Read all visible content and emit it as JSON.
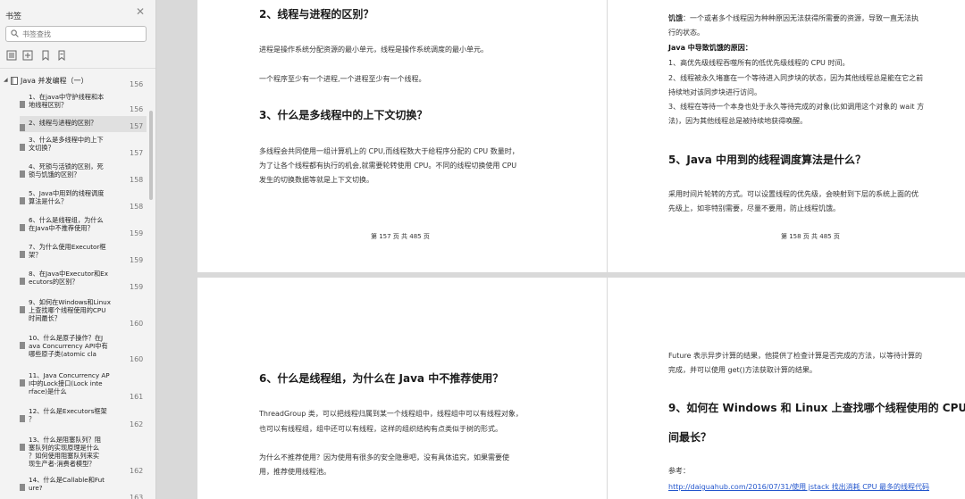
{
  "sidebar": {
    "title": "书签",
    "search_placeholder": "书签查找",
    "root": {
      "label": "Java 并发编程（一）",
      "page": "156"
    },
    "items": [
      {
        "label": "1、在java中守护线程和本\n地线程区别？",
        "page": "156"
      },
      {
        "label": "2、线程与进程的区别？",
        "page": "157"
      },
      {
        "label": "3、什么是多线程中的上下\n文切换？",
        "page": "157"
      },
      {
        "label": "4、死锁与活锁的区别，死\n锁与饥饿的区别？",
        "page": "158"
      },
      {
        "label": "5、Java中用到的线程调度\n算法是什么？",
        "page": "158"
      },
      {
        "label": "6、什么是线程组，为什么\n在Java中不推荐使用？",
        "page": "159"
      },
      {
        "label": "7、为什么使用Executor框\n架？",
        "page": "159"
      },
      {
        "label": "8、在Java中Executor和Ex\necutors的区别？",
        "page": "159"
      },
      {
        "label": "9、如何在Windows和Linux\n上查找哪个线程使用的CPU\n时间最长？",
        "page": "160"
      },
      {
        "label": "10、什么是原子操作？在J\nava Concurrency API中有\n哪些原子类(atomic cla",
        "page": "160"
      },
      {
        "label": "11、Java Concurrency AP\nI中的Lock接口(Lock inte\nrface)是什么",
        "page": "161"
      },
      {
        "label": "12、什么是Executors框架\n？",
        "page": "162"
      },
      {
        "label": "13、什么是阻塞队列？阻\n塞队列的实现原理是什么\n？如何使用阻塞队列来实\n现生产者-消费者模型？",
        "page": "162"
      },
      {
        "label": "14、什么是Callable和Fut\nure?",
        "page": "163"
      }
    ]
  },
  "pages": {
    "p1": {
      "heading1": "2、线程与进程的区别？",
      "para1": "进程是操作系统分配资源的最小单元，线程是操作系统调度的最小单元。",
      "para2": "一个程序至少有一个进程,一个进程至少有一个线程。",
      "heading2": "3、什么是多线程中的上下文切换？",
      "para3_l1": "多线程会共同使用一组计算机上的 CPU,而线程数大于给程序分配的 CPU 数量时，",
      "para3_l2": "为了让各个线程都有执行的机会,就需要轮转使用 CPU。不同的线程切换使用 CPU",
      "para3_l3": "发生的切换数据等就是上下文切换。",
      "footer": "第 157 页 共 485 页"
    },
    "p2": {
      "l1_bold": "饥饿",
      "l1_rest": "：一个或者多个线程因为种种原因无法获得所需要的资源，导致一直无法执",
      "l2": "行的状态。",
      "l3": "Java 中导致饥饿的原因：",
      "l4": "1、高优先级线程吞噬所有的低优先级线程的 CPU 时间。",
      "l5": "2、线程被永久堵塞在一个等待进入同步块的状态，因为其他线程总是能在它之前",
      "l6": "持续地对该同步块进行访问。",
      "l7": "3、线程在等待一个本身也处于永久等待完成的对象(比如调用这个对象的 wait 方",
      "l8": "法)，因为其他线程总是被持续地获得唤醒。",
      "heading": "5、Java 中用到的线程调度算法是什么？",
      "p_l1": "采用时间片轮转的方式。可以设置线程的优先级，会映射到下层的系统上面的优",
      "p_l2": "先级上，如非特别需要，尽量不要用，防止线程饥饿。",
      "footer": "第 158 页 共 485 页"
    },
    "p3": {
      "heading": "6、什么是线程组，为什么在 Java 中不推荐使用？",
      "l1": "ThreadGroup 类，可以把线程归属到某一个线程组中，线程组中可以有线程对象，",
      "l2": "也可以有线程组，组中还可以有线程，这样的组织结构有点类似于树的形式。",
      "l3": "为什么不推荐使用？因为使用有很多的安全隐患吧，没有具体追究，如果需要使",
      "l4": "用，推荐使用线程池。"
    },
    "p4": {
      "l1": "Future 表示异步计算的结果，他提供了检查计算是否完成的方法，以等待计算的",
      "l2": "完成，并可以使用 get()方法获取计算的结果。",
      "heading_l1": "9、如何在 Windows 和 Linux 上查找哪个线程使用的 CPU 时",
      "heading_l2": "间最长？",
      "ref": "参考：",
      "link": "http://daiguahub.com/2016/07/31/使用 jstack 找出消耗 CPU 最多的线程代码"
    }
  }
}
